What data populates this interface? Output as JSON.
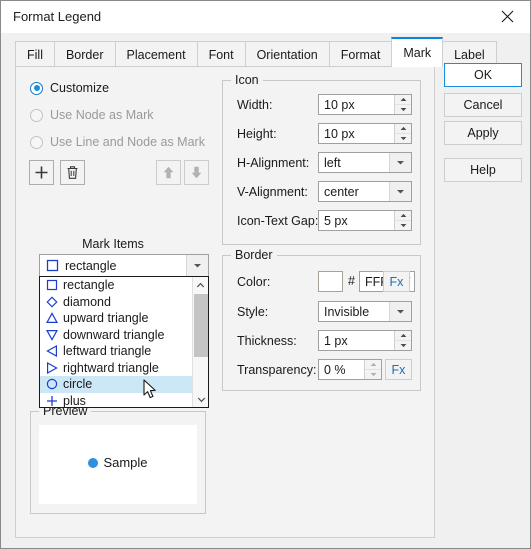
{
  "window": {
    "title": "Format Legend",
    "close_icon": "close-icon"
  },
  "tabs": [
    {
      "label": "Fill",
      "active": false
    },
    {
      "label": "Border",
      "active": false
    },
    {
      "label": "Placement",
      "active": false
    },
    {
      "label": "Font",
      "active": false
    },
    {
      "label": "Orientation",
      "active": false
    },
    {
      "label": "Format",
      "active": false
    },
    {
      "label": "Mark",
      "active": true
    },
    {
      "label": "Label",
      "active": false
    }
  ],
  "mark_tab": {
    "radios": [
      {
        "label": "Customize",
        "checked": true,
        "disabled": false
      },
      {
        "label": "Use Node as Mark",
        "checked": false,
        "disabled": true
      },
      {
        "label": "Use Line and Node as Mark",
        "checked": false,
        "disabled": true
      }
    ],
    "toolbar": {
      "add_icon": "plus-icon",
      "delete_icon": "trash-icon",
      "move_up_icon": "arrow-up-icon",
      "move_down_icon": "arrow-down-icon"
    },
    "mark_items": {
      "group_label": "Mark Items",
      "selected_value": "rectangle",
      "selected_glyph": "square-icon",
      "dropdown_arrow_icon": "chevron-down-icon",
      "options": [
        {
          "label": "rectangle",
          "glyph": "square-icon",
          "selected": false
        },
        {
          "label": "diamond",
          "glyph": "diamond-icon",
          "selected": false
        },
        {
          "label": "upward triangle",
          "glyph": "triangle-up-icon",
          "selected": false
        },
        {
          "label": "downward triangle",
          "glyph": "triangle-down-icon",
          "selected": false
        },
        {
          "label": "leftward triangle",
          "glyph": "triangle-left-icon",
          "selected": false
        },
        {
          "label": "rightward triangle",
          "glyph": "triangle-right-icon",
          "selected": false
        },
        {
          "label": "circle",
          "glyph": "circle-icon",
          "selected": true
        },
        {
          "label": "plus",
          "glyph": "plus-shape-icon",
          "selected": false
        }
      ],
      "scrollbar": {
        "up_icon": "chevron-up-icon",
        "down_icon": "chevron-down-icon"
      }
    },
    "preview": {
      "group_label": "Preview",
      "sample_text": "Sample",
      "sample_mark_icon": "circle-filled-icon",
      "sample_color": "#2E8FE0"
    },
    "icon_group": {
      "group_label": "Icon",
      "rows": [
        {
          "label": "Width:",
          "value": "10 px",
          "control": "spinner"
        },
        {
          "label": "Height:",
          "value": "10 px",
          "control": "spinner"
        },
        {
          "label": "H-Alignment:",
          "value": "left",
          "control": "combo"
        },
        {
          "label": "V-Alignment:",
          "value": "center",
          "control": "combo"
        },
        {
          "label": "Icon-Text Gap:",
          "value": "5 px",
          "control": "spinner"
        }
      ]
    },
    "border_group": {
      "group_label": "Border",
      "color": {
        "label": "Color:",
        "swatch_color": "#FFFFFF",
        "hash": "#",
        "hex_value": "FFFFFF",
        "fx_label": "Fx"
      },
      "style": {
        "label": "Style:",
        "value": "Invisible"
      },
      "thickness": {
        "label": "Thickness:",
        "value": "1 px"
      },
      "transparency": {
        "label": "Transparency:",
        "value": "0 %",
        "fx_label": "Fx"
      }
    }
  },
  "buttons": {
    "ok": "OK",
    "cancel": "Cancel",
    "apply": "Apply",
    "help": "Help"
  }
}
